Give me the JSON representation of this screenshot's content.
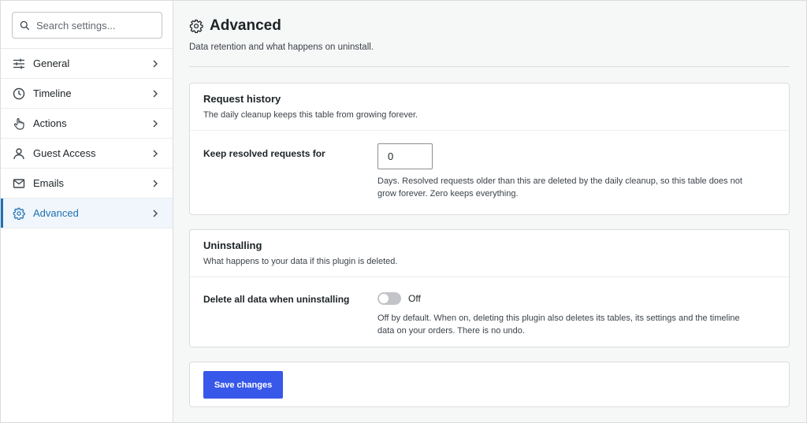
{
  "search": {
    "placeholder": "Search settings..."
  },
  "sidebar": {
    "items": [
      {
        "label": "General",
        "icon": "sliders-icon"
      },
      {
        "label": "Timeline",
        "icon": "clock-icon"
      },
      {
        "label": "Actions",
        "icon": "hand-pointer-icon"
      },
      {
        "label": "Guest Access",
        "icon": "user-icon"
      },
      {
        "label": "Emails",
        "icon": "envelope-icon"
      },
      {
        "label": "Advanced",
        "icon": "gear-icon",
        "active": true
      }
    ]
  },
  "page": {
    "title": "Advanced",
    "description": "Data retention and what happens on uninstall."
  },
  "request_history": {
    "title": "Request history",
    "subtitle": "The daily cleanup keeps this table from growing forever.",
    "field_label": "Keep resolved requests for",
    "field_value": "0",
    "help_line1": "Days. Resolved requests older than this are deleted by the daily cleanup, so this table does not",
    "help_line2": "grow forever. Zero keeps everything."
  },
  "uninstalling": {
    "title": "Uninstalling",
    "subtitle": "What happens to your data if this plugin is deleted.",
    "field_label": "Delete all data when uninstalling",
    "toggle_state": "Off",
    "toggle_on": false,
    "help_line1": "Off by default. When on, deleting this plugin also deletes its tables, its settings and the timeline",
    "help_line2": "data on your orders. There is no undo."
  },
  "actions": {
    "save_label": "Save changes"
  },
  "colors": {
    "accent": "#2271b1",
    "button": "#3858e9",
    "toggle_off": "#c3c4c7"
  }
}
